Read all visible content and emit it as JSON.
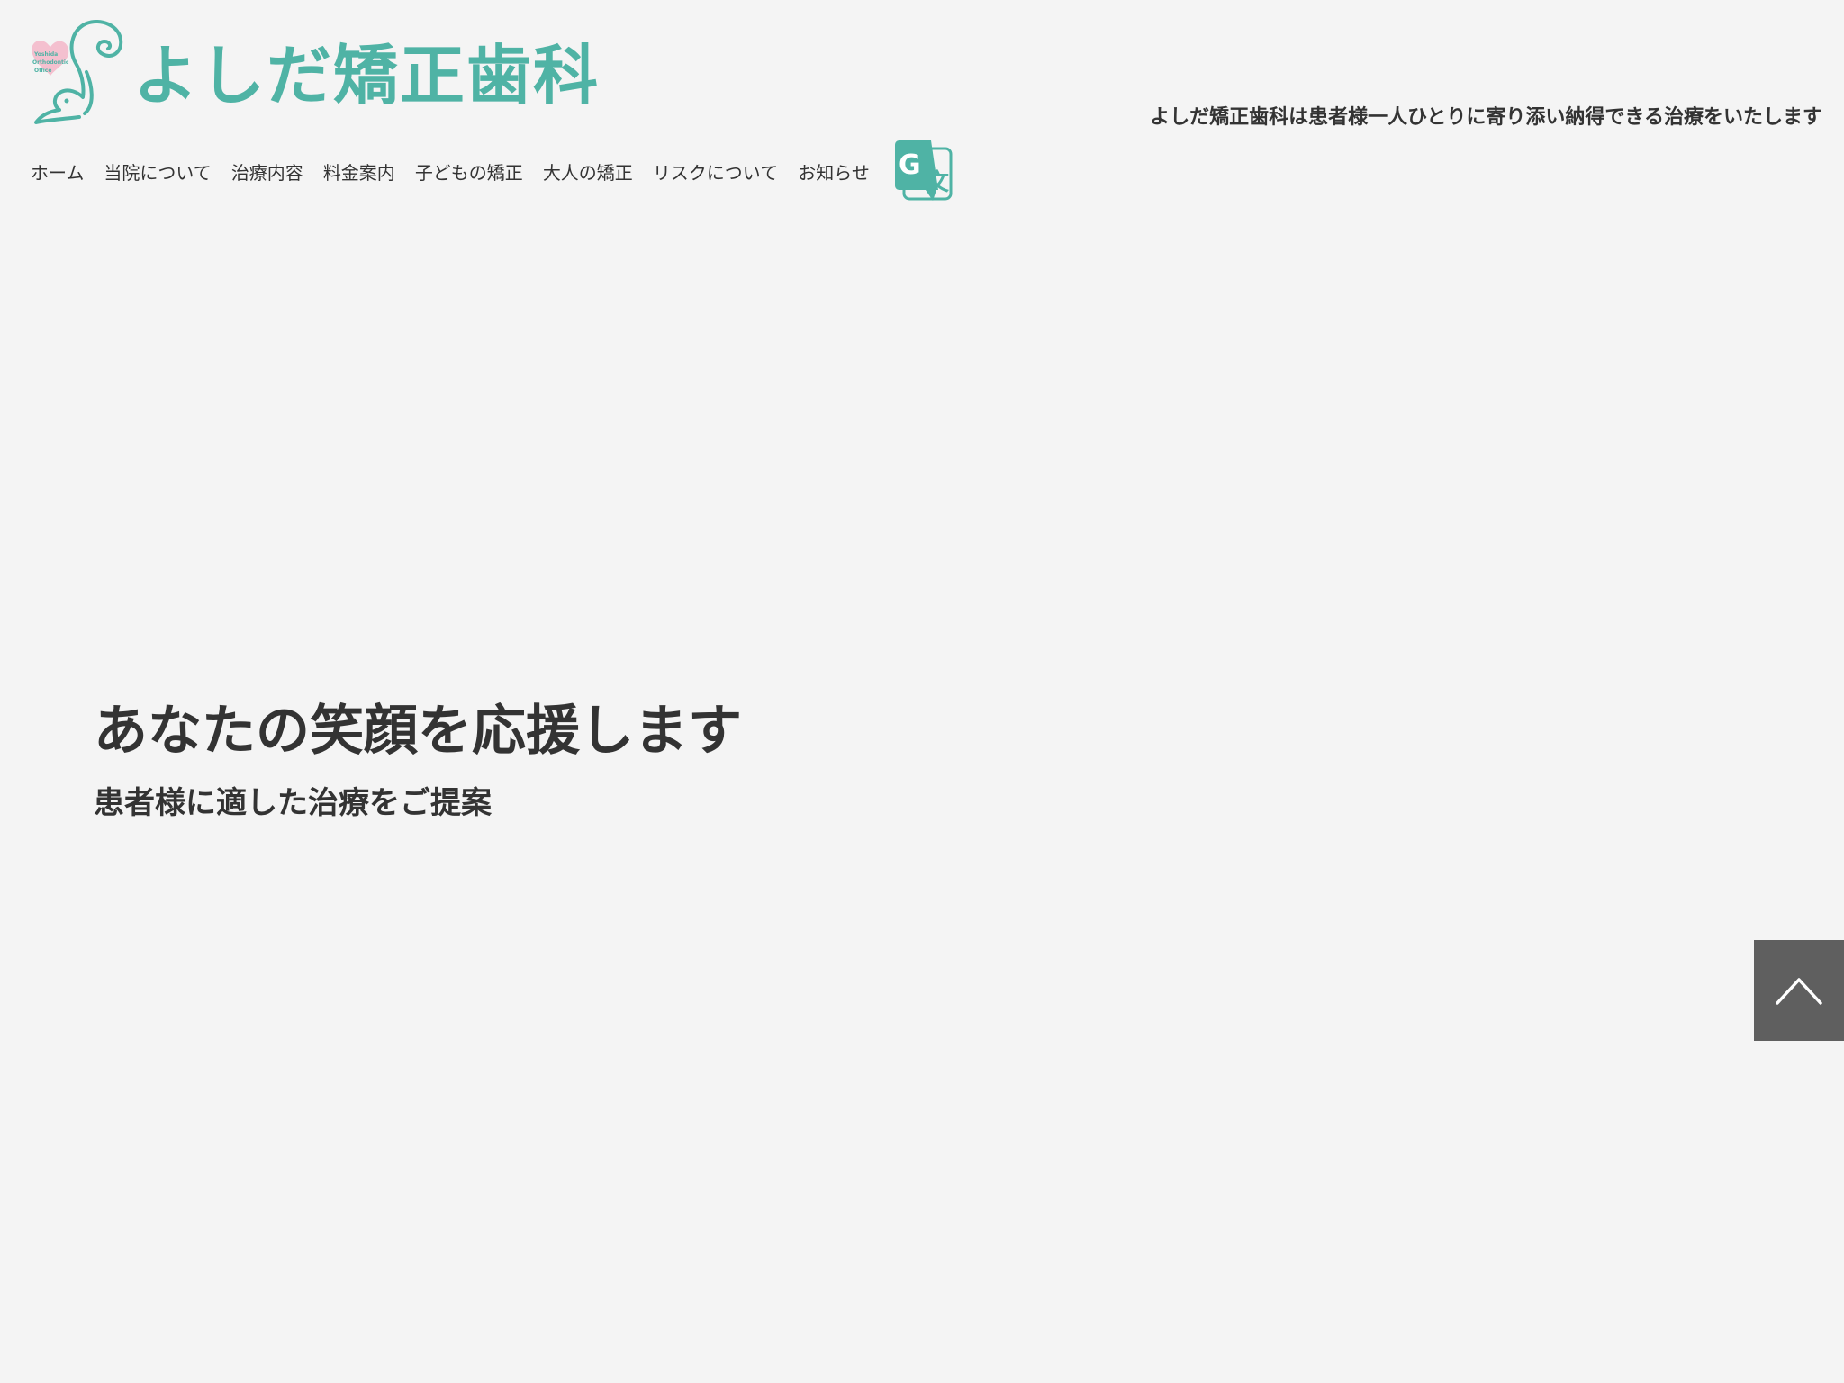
{
  "header": {
    "logo_text": "よしだ矯正歯科",
    "logo_badge_lines": [
      "Yoshida",
      "Orthodontic",
      "Office"
    ],
    "tagline": "よしだ矯正歯科は患者様一人ひとりに寄り添い納得できる治療をいたします",
    "logo_aria": "よしだ矯正歯科"
  },
  "nav": {
    "items": [
      {
        "label": "ホーム"
      },
      {
        "label": "当院について"
      },
      {
        "label": "治療内容"
      },
      {
        "label": "料金案内"
      },
      {
        "label": "子どもの矯正"
      },
      {
        "label": "大人の矯正"
      },
      {
        "label": "リスクについて"
      },
      {
        "label": "お知らせ"
      }
    ],
    "translate_icon": "google-translate-icon"
  },
  "hero": {
    "title": "あなたの笑顔を応援します",
    "subtitle": "患者様に適した治療をご提案"
  },
  "page_top": {
    "icon": "chevron-up-icon"
  },
  "colors": {
    "background": "#f4f4f4",
    "brand": "#4fb3a5",
    "text": "#333333",
    "pagetop_bg": "#5f5f5f",
    "badge_pink": "#f3b6c8"
  }
}
